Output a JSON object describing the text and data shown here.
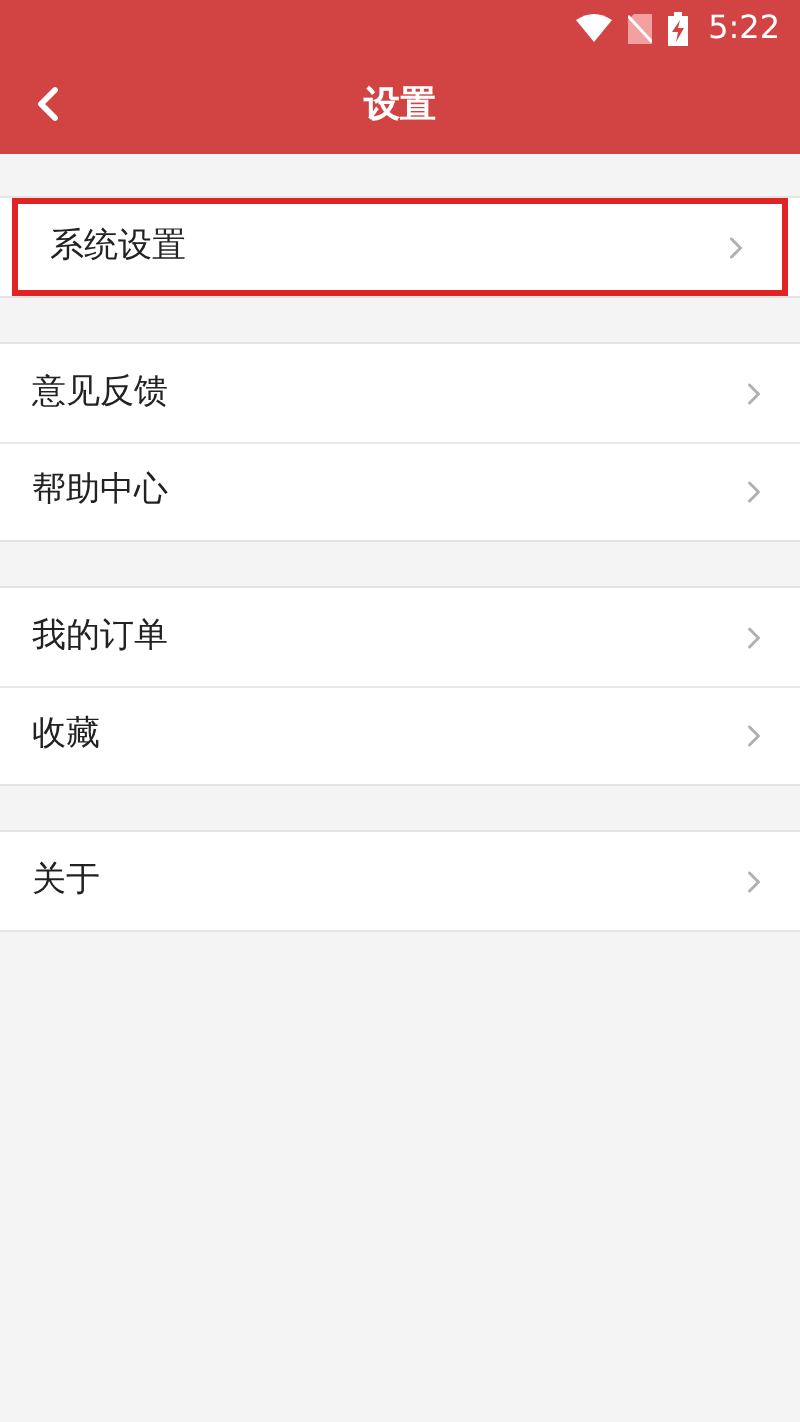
{
  "status_bar": {
    "time": "5:22"
  },
  "header": {
    "title": "设置"
  },
  "groups": [
    {
      "items": [
        {
          "label": "系统设置",
          "selected": true
        }
      ]
    },
    {
      "items": [
        {
          "label": "意见反馈",
          "selected": false
        },
        {
          "label": "帮助中心",
          "selected": false
        }
      ]
    },
    {
      "items": [
        {
          "label": "我的订单",
          "selected": false
        },
        {
          "label": "收藏",
          "selected": false
        }
      ]
    },
    {
      "items": [
        {
          "label": "关于",
          "selected": false
        }
      ]
    }
  ]
}
